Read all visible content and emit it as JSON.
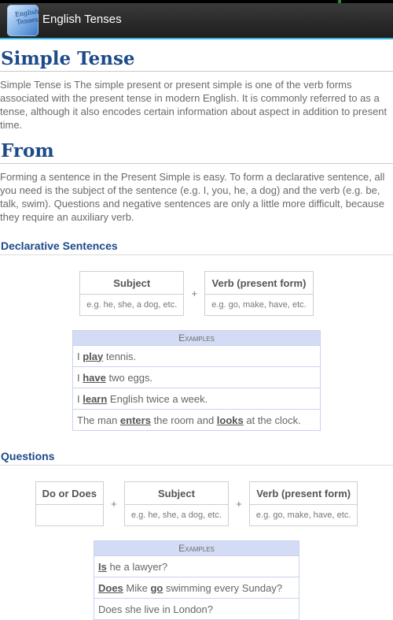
{
  "app": {
    "title": "English Tenses",
    "icon": "english-tenses-app-icon",
    "icon_text": [
      "English",
      "Tenses"
    ]
  },
  "section1": {
    "heading": "Simple Tense",
    "text": "Simple Tense is The simple present or present simple is one of the verb forms associated with the present tense in modern English. It is commonly referred to as a tense, although it also encodes certain information about aspect in addition to present time."
  },
  "section2": {
    "heading": "From",
    "text": "Forming a sentence in the Present Simple is easy. To form a declarative sentence, all you need is the subject of the sentence (e.g. I, you, he, a dog) and the verb (e.g. be, talk, swim). Questions and negative sentences are only a little more difficult, because they require an auxiliary verb."
  },
  "declarative": {
    "heading": "Declarative Sentences",
    "form": {
      "subject_header": "Subject",
      "verb_header": "Verb (present form)",
      "plus": "+",
      "subject_example": "e.g. he, she, a dog, etc.",
      "verb_example": "e.g. go, make, have, etc."
    },
    "examples_header": "Examples",
    "examples": [
      {
        "before": "I ",
        "verb": "play",
        "after": " tennis."
      },
      {
        "before": "I ",
        "verb": "have",
        "after": " two eggs."
      },
      {
        "before": "I ",
        "verb": "learn",
        "after": " English twice a week."
      },
      {
        "before": "The man ",
        "verb": "enters",
        "after": " the room and ",
        "verb2": "looks",
        "after2": " at the clock."
      }
    ]
  },
  "questions": {
    "heading": "Questions",
    "form": {
      "aux_header": "Do or Does",
      "subject_header": "Subject",
      "verb_header": "Verb (present form)",
      "plus": "+",
      "subject_example": "e.g. he, she, a dog, etc.",
      "verb_example": "e.g. go, make, have, etc."
    },
    "examples_header": "Examples",
    "examples": [
      {
        "a": "Is",
        "b": " he a lawyer?"
      },
      {
        "a": "Does",
        "b": " Mike ",
        "c": "go",
        "d": " swimming every Sunday?"
      },
      {
        "a": "",
        "b": "Does she live in London?"
      }
    ]
  }
}
